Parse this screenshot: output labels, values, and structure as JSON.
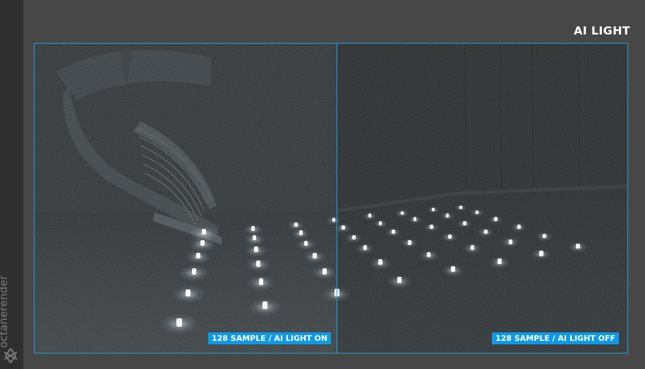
{
  "page": {
    "title": "AI LIGHT"
  },
  "brand": {
    "name": "octanerender",
    "trademark": "™",
    "icon": "octane-logo-icon"
  },
  "comparison": {
    "left_label": "128 SAMPLE / AI LIGHT ON",
    "right_label": "128 SAMPLE / AI LIGHT OFF"
  },
  "colors": {
    "accent": "#1aa3e8",
    "label_bg": "#0d9ae6",
    "background": "#474747",
    "sidebar": "#2f2f2f"
  }
}
